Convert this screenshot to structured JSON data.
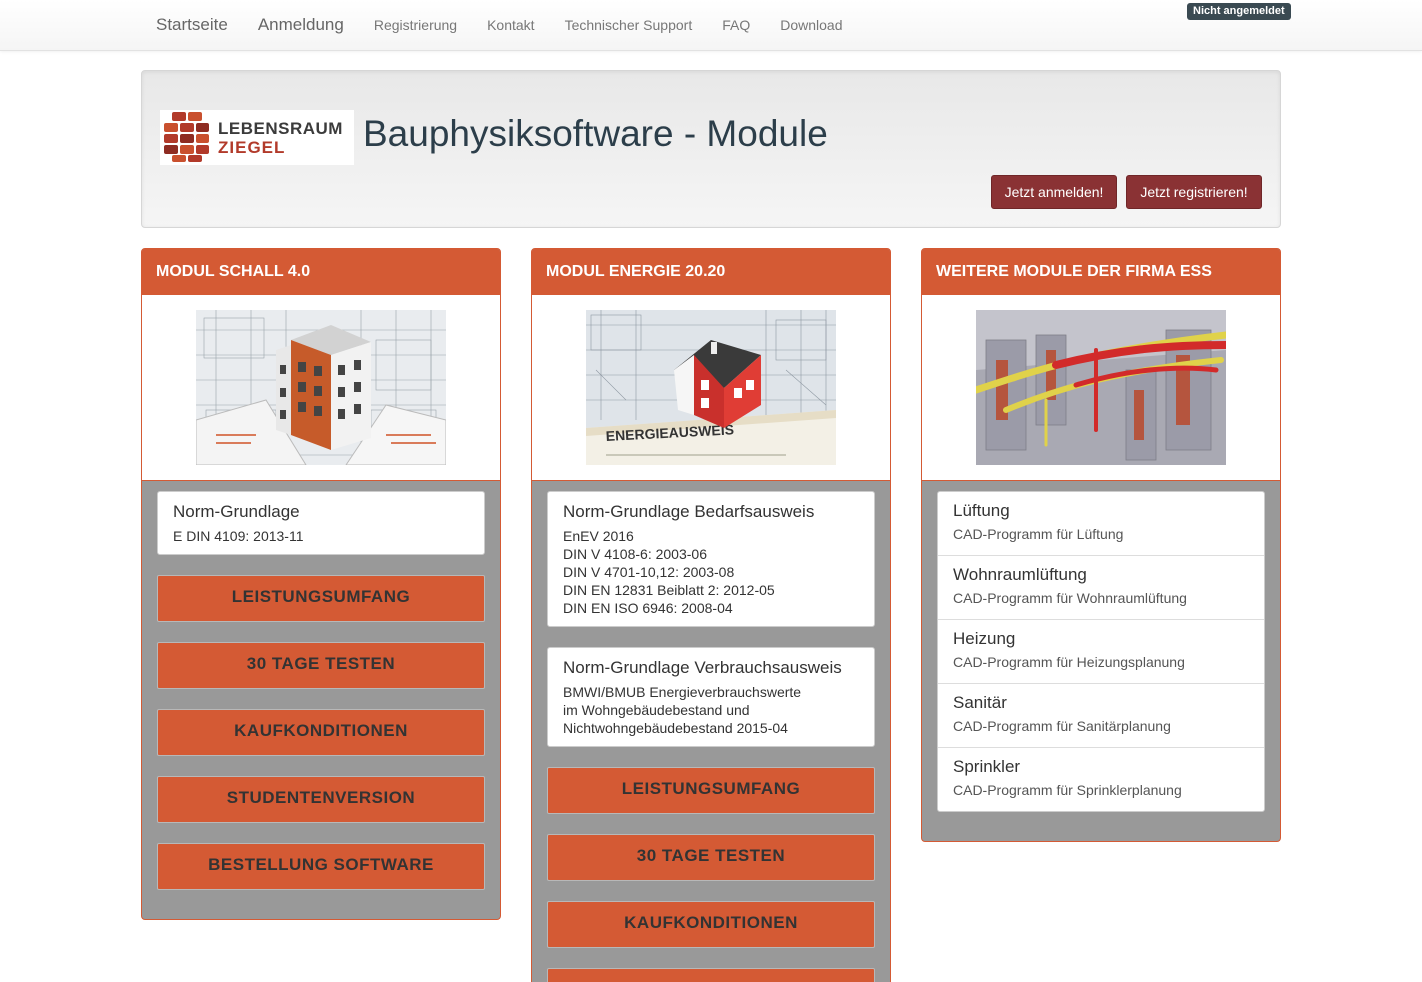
{
  "nav": {
    "items": [
      "Startseite",
      "Anmeldung",
      "Registrierung",
      "Kontakt",
      "Technischer Support",
      "FAQ",
      "Download"
    ],
    "status": "Nicht angemeldet"
  },
  "header": {
    "logo_line1": "LEBENSRAUM",
    "logo_line2": "ZIEGEL",
    "title": "Bauphysiksoftware - Module",
    "login_button": "Jetzt anmelden!",
    "register_button": "Jetzt registrieren!"
  },
  "colors": {
    "accent": "#d45a34",
    "button_dark_red": "#8a3234",
    "panel_bg": "#999999"
  },
  "panel_schall": {
    "title": "MODUL SCHALL 4.0",
    "image": "building-on-blueprints",
    "norm_title": "Norm-Grundlage",
    "norm_lines": [
      "E DIN 4109: 2013-11"
    ],
    "buttons": [
      "LEISTUNGSUMFANG",
      "30 TAGE TESTEN",
      "KAUFKONDITIONEN",
      "STUDENTENVERSION",
      "BESTELLUNG SOFTWARE"
    ]
  },
  "panel_energie": {
    "title": "MODUL ENERGIE 20.20",
    "image": "house-energieausweis",
    "image_text": "ENERGIEAUSWEIS",
    "norm1_title": "Norm-Grundlage Bedarfsausweis",
    "norm1_lines": [
      "EnEV 2016",
      "DIN V 4108-6: 2003-06",
      "DIN V 4701-10,12: 2003-08",
      "DIN EN 12831 Beiblatt 2: 2012-05",
      "DIN EN ISO 6946: 2008-04"
    ],
    "norm2_title": "Norm-Grundlage Verbrauchsausweis",
    "norm2_lines": [
      "BMWI/BMUB Energieverbrauchswerte",
      "im Wohngebäudebestand und",
      "Nichtwohngebäudebestand 2015-04"
    ],
    "buttons": [
      "LEISTUNGSUMFANG",
      "30 TAGE TESTEN",
      "KAUFKONDITIONEN",
      ""
    ]
  },
  "panel_weitere": {
    "title": "WEITERE MODULE DER FIRMA ESS",
    "image": "3d-ventilation-ducts",
    "items": [
      {
        "title": "Lüftung",
        "desc": "CAD-Programm für Lüftung"
      },
      {
        "title": "Wohnraumlüftung",
        "desc": "CAD-Programm für Wohnraumlüftung"
      },
      {
        "title": "Heizung",
        "desc": "CAD-Programm für Heizungsplanung"
      },
      {
        "title": "Sanitär",
        "desc": "CAD-Programm für Sanitärplanung"
      },
      {
        "title": "Sprinkler",
        "desc": "CAD-Programm für Sprinklerplanung"
      }
    ]
  }
}
